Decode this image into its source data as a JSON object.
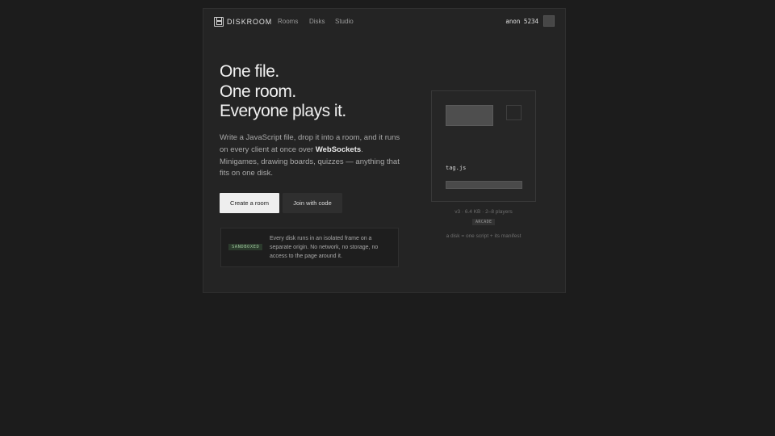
{
  "app": {
    "name": "DISKROOM",
    "logo_icon": "floppy-disk-icon"
  },
  "nav": {
    "items": [
      {
        "label": "Rooms"
      },
      {
        "label": "Disks"
      },
      {
        "label": "Studio"
      }
    ]
  },
  "user": {
    "name": "anon 5234"
  },
  "hero": {
    "lines": [
      "One file.",
      "One room.",
      "Everyone plays it."
    ]
  },
  "lead": {
    "before": "Write a JavaScript file, drop it into a room, and it runs on every client at once over ",
    "strong": "WebSockets",
    "after": ". Minigames, drawing boards, quizzes — anything that fits on one disk."
  },
  "actions": {
    "primary": "Create a room",
    "secondary": "Join with code"
  },
  "notice": {
    "badge": "SANDBOXED",
    "text": "Every disk runs in an isolated frame on a separate origin. No network, no storage, no access to the page around it."
  },
  "disk": {
    "filename": "tag.js",
    "meta": "v3 · 6.4 KB · 2–8 players",
    "tag": "ARCADE",
    "caption": "a disk = one script + its manifest"
  },
  "colors": {
    "background": "#1c1c1c",
    "panel": "#242424",
    "primary_button": "#eeeeee",
    "badge_green": "#9bc29a"
  }
}
